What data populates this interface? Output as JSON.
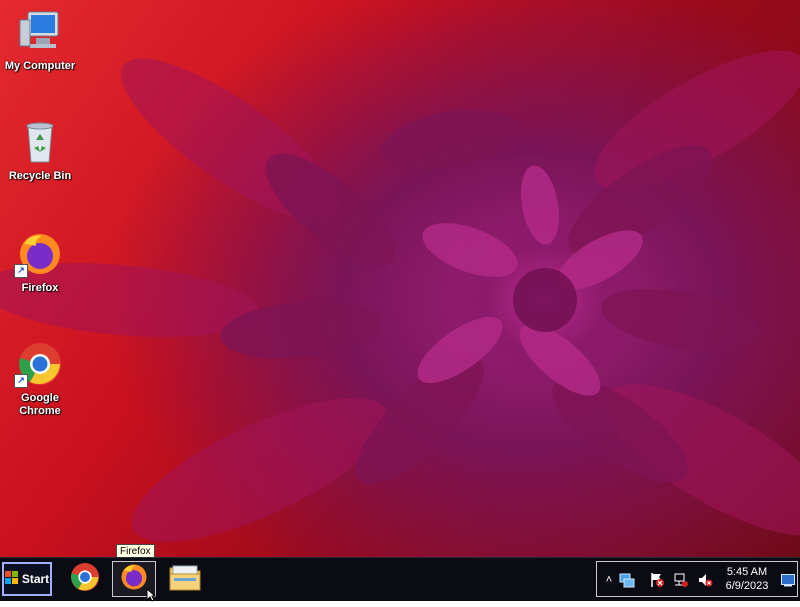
{
  "desktop": {
    "icons": [
      {
        "label": "My Computer",
        "icon": "computer-icon"
      },
      {
        "label": "Recycle Bin",
        "icon": "recycle-bin-icon"
      },
      {
        "label": "Firefox",
        "icon": "firefox-icon"
      },
      {
        "label": "Google Chrome",
        "icon": "chrome-icon"
      }
    ]
  },
  "taskbar": {
    "start_label": "Start",
    "buttons": [
      {
        "icon": "chrome-icon",
        "active": false
      },
      {
        "icon": "firefox-icon",
        "active": true
      },
      {
        "icon": "file-explorer-icon",
        "active": false
      }
    ],
    "tooltip": "Firefox",
    "tray": {
      "icons": [
        "show-hidden-icons-chevron",
        "network-icon",
        "action-center-flag-icon",
        "network-connection-icon",
        "volume-muted-icon"
      ],
      "time": "5:45 AM",
      "date": "6/9/2023"
    }
  },
  "colors": {
    "wallpaper_red": "#c8101e",
    "flower_magenta": "#9a2377",
    "taskbar_bg": "#0b0b14"
  }
}
